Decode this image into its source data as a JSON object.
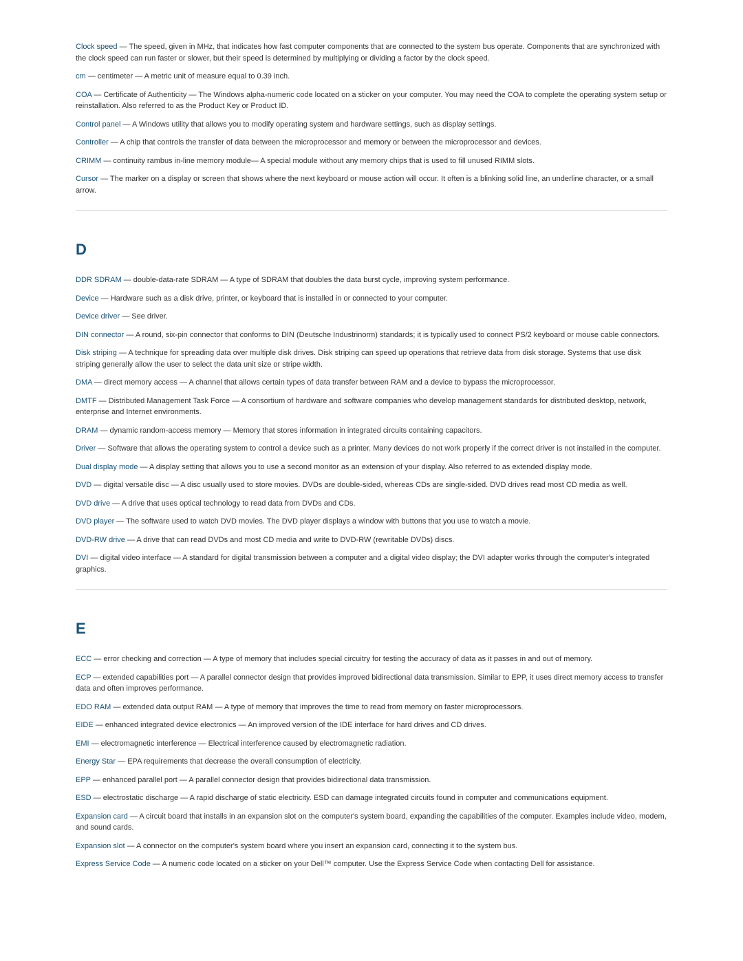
{
  "sections": [
    {
      "letter": null,
      "entries": [
        {
          "term": "Clock speed",
          "definition": " — The speed, given in MHz, that indicates how fast computer components that are connected to the system bus operate. Components that are synchronized with the clock speed can run faster or slower, but their speed is determined by multiplying or dividing a factor by the clock speed."
        },
        {
          "term": "cm",
          "definition": " — centimeter — A metric unit of measure equal to 0.39 inch."
        },
        {
          "term": "COA",
          "definition": " — Certificate of Authenticity — The Windows alpha-numeric code located on a sticker on your computer. You may need the COA to complete the operating system setup or reinstallation. Also referred to as the Product Key or Product ID."
        },
        {
          "term": "Control panel",
          "definition": " — A Windows utility that allows you to modify operating system and hardware settings, such as display settings."
        },
        {
          "term": "Controller",
          "definition": " — A chip that controls the transfer of data between the microprocessor and memory or between the microprocessor and devices."
        },
        {
          "term": "CRIMM",
          "definition": " — continuity rambus in-line memory module— A special module without any memory chips that is used to fill unused RIMM slots."
        },
        {
          "term": "Cursor",
          "definition": " — The marker on a display or screen that shows where the next keyboard or mouse action will occur. It often is a blinking solid line, an underline character, or a small arrow."
        }
      ]
    },
    {
      "letter": "D",
      "entries": [
        {
          "term": "DDR SDRAM",
          "definition": " — double-data-rate SDRAM — A type of SDRAM that doubles the data burst cycle, improving system performance."
        },
        {
          "term": "Device",
          "definition": " — Hardware such as a disk drive, printer, or keyboard that is installed in or connected to your computer."
        },
        {
          "term": "Device driver",
          "definition": " — See driver."
        },
        {
          "term": "DIN connector",
          "definition": " — A round, six-pin connector that conforms to DIN (Deutsche Industrinorm) standards; it is typically used to connect PS/2 keyboard or mouse cable connectors."
        },
        {
          "term": "Disk striping",
          "definition": " — A technique for spreading data over multiple disk drives. Disk striping can speed up operations that retrieve data from disk storage. Systems that use disk striping generally allow the user to select the data unit size or stripe width."
        },
        {
          "term": "DMA",
          "definition": " — direct memory access — A channel that allows certain types of data transfer between RAM and a device to bypass the microprocessor."
        },
        {
          "term": "DMTF",
          "definition": " — Distributed Management Task Force — A consortium of hardware and software companies who develop management standards for distributed desktop, network, enterprise and Internet environments."
        },
        {
          "term": "DRAM",
          "definition": " — dynamic random-access memory — Memory that stores information in integrated circuits containing capacitors."
        },
        {
          "term": "Driver",
          "definition": " — Software that allows the operating system to control a device such as a printer. Many devices do not work properly if the correct driver is not installed in the computer."
        },
        {
          "term": "Dual display mode",
          "definition": " — A display setting that allows you to use a second monitor as an extension of your display. Also referred to as extended display mode."
        },
        {
          "term": "DVD",
          "definition": " — digital versatile disc — A disc usually used to store movies. DVDs are double-sided, whereas CDs are single-sided. DVD drives read most CD media as well."
        },
        {
          "term": "DVD drive",
          "definition": " — A drive that uses optical technology to read data from DVDs and CDs."
        },
        {
          "term": "DVD player",
          "definition": " — The software used to watch DVD movies. The DVD player displays a window with buttons that you use to watch a movie."
        },
        {
          "term": "DVD-RW drive",
          "definition": " — A drive that can read DVDs and most CD media and write to DVD-RW (rewritable DVDs) discs."
        },
        {
          "term": "DVI",
          "definition": " — digital video interface — A standard for digital transmission between a computer and a digital video display; the DVI adapter works through the computer's integrated graphics."
        }
      ]
    },
    {
      "letter": "E",
      "entries": [
        {
          "term": "ECC",
          "definition": " — error checking and correction — A type of memory that includes special circuitry for testing the accuracy of data as it passes in and out of memory."
        },
        {
          "term": "ECP",
          "definition": " — extended capabilities port — A parallel connector design that provides improved bidirectional data transmission. Similar to EPP, it uses direct memory access to transfer data and often improves performance."
        },
        {
          "term": "EDO RAM",
          "definition": " — extended data output RAM — A type of memory that improves the time to read from memory on faster microprocessors."
        },
        {
          "term": "EIDE",
          "definition": " — enhanced integrated device electronics — An improved version of the IDE interface for hard drives and CD drives."
        },
        {
          "term": "EMI",
          "definition": " — electromagnetic interference — Electrical interference caused by electromagnetic radiation."
        },
        {
          "term": "Energy Star",
          "definition": " — EPA requirements that decrease the overall consumption of electricity."
        },
        {
          "term": "EPP",
          "definition": " — enhanced parallel port — A parallel connector design that provides bidirectional data transmission."
        },
        {
          "term": "ESD",
          "definition": " — electrostatic discharge — A rapid discharge of static electricity. ESD can damage integrated circuits found in computer and communications equipment."
        },
        {
          "term": "Expansion card",
          "definition": " — A circuit board that installs in an expansion slot on the computer's system board, expanding the capabilities of the computer. Examples include video, modem, and sound cards."
        },
        {
          "term": "Expansion slot",
          "definition": " — A connector on the computer's system board where you insert an expansion card, connecting it to the system bus."
        },
        {
          "term": "Express Service Code",
          "definition": " — A numeric code located on a sticker on your Dell™ computer. Use the Express Service Code when contacting Dell for assistance."
        }
      ]
    }
  ]
}
